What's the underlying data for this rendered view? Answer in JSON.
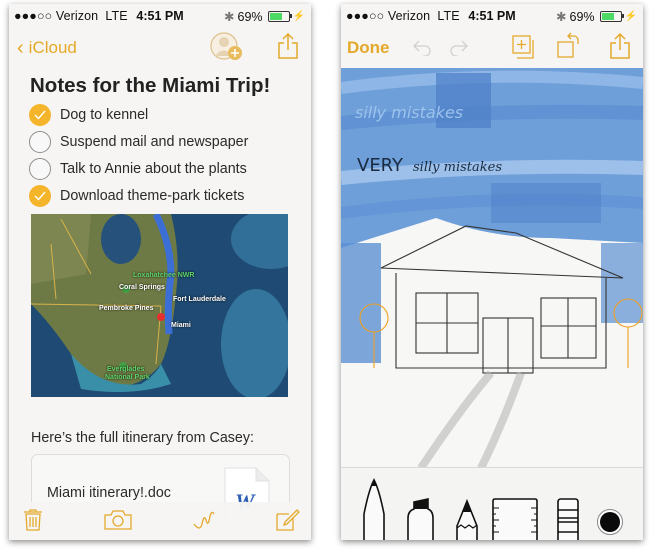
{
  "status_bar": {
    "signal": "●●●○○",
    "carrier": "Verizon",
    "network": "LTE",
    "time": "4:51 PM",
    "battery": "69%",
    "battery_level": 0.69,
    "bluetooth_icon": "bluetooth-icon",
    "charging_icon": "bolt-icon"
  },
  "colors": {
    "accent": "#e4a92a",
    "check_fill": "#f5b52b",
    "ink_blue": "#2f6fc9",
    "marker_orange": "#f0a020",
    "battery_green": "#4cd964"
  },
  "left_screen": {
    "nav": {
      "back_label": "iCloud",
      "back_icon": "chevron-left-icon",
      "add_person_icon": "add-person-icon",
      "share_icon": "share-icon"
    },
    "note_title": "Notes for the Miami Trip!",
    "checklist": [
      {
        "label": "Dog to kennel",
        "checked": true
      },
      {
        "label": "Suspend mail and newspaper",
        "checked": false
      },
      {
        "label": "Talk to Annie about the plants",
        "checked": false
      },
      {
        "label": "Download theme-park tickets",
        "checked": true
      }
    ],
    "map": {
      "labels": {
        "loxahatchee": "Loxahatchee NWR",
        "coral_springs": "Coral Springs",
        "fort_lauderdale": "Fort Lauderdale",
        "pembroke_pines": "Pembroke Pines",
        "miami": "Miami",
        "everglades_1": "Everglades",
        "everglades_2": "National Park"
      }
    },
    "itinerary_text": "Here’s the full itinerary from Casey:",
    "attachment": {
      "name": "Miami itinerary!.doc",
      "icon_letter": "W"
    },
    "toolbar": [
      "trash-icon",
      "camera-icon",
      "sketch-icon",
      "compose-icon"
    ]
  },
  "right_screen": {
    "nav": {
      "done_label": "Done",
      "undo_icon": "undo-icon",
      "redo_icon": "redo-icon",
      "add_page_icon": "add-page-icon",
      "rotate_icon": "rotate-icon",
      "share_icon": "share-icon"
    },
    "handwriting": {
      "faint": "silly mistakes",
      "bold_word": "VERY",
      "rest": "silly mistakes"
    },
    "tools": [
      "pen-tool",
      "marker-tool",
      "pencil-tool",
      "ruler-tool",
      "eraser-tool",
      "color-picker"
    ]
  }
}
